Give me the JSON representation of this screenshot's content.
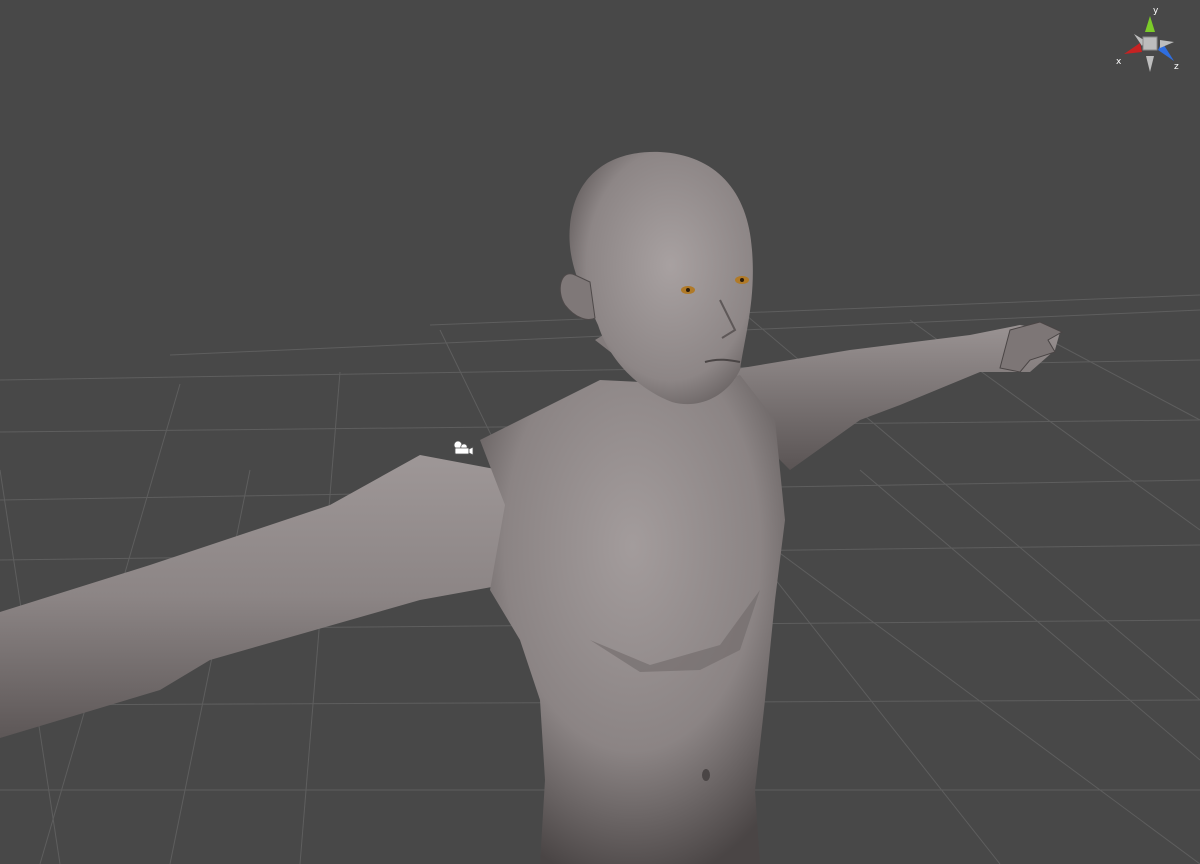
{
  "viewport": {
    "background": "#484848",
    "grid_color": "#5c5c5c"
  },
  "model": {
    "skin_color": "#8f8888",
    "shadow_color": "#3e3a3a",
    "eye_color": "#b07a28"
  },
  "gizmo": {
    "x_label": "x",
    "y_label": "y",
    "z_label": "z",
    "x_color": "#c62222",
    "y_color": "#7ccc29",
    "z_color": "#2f6ee0",
    "center_color": "#bdbdbd"
  },
  "icons": {
    "camera_marker": "camera-icon"
  }
}
